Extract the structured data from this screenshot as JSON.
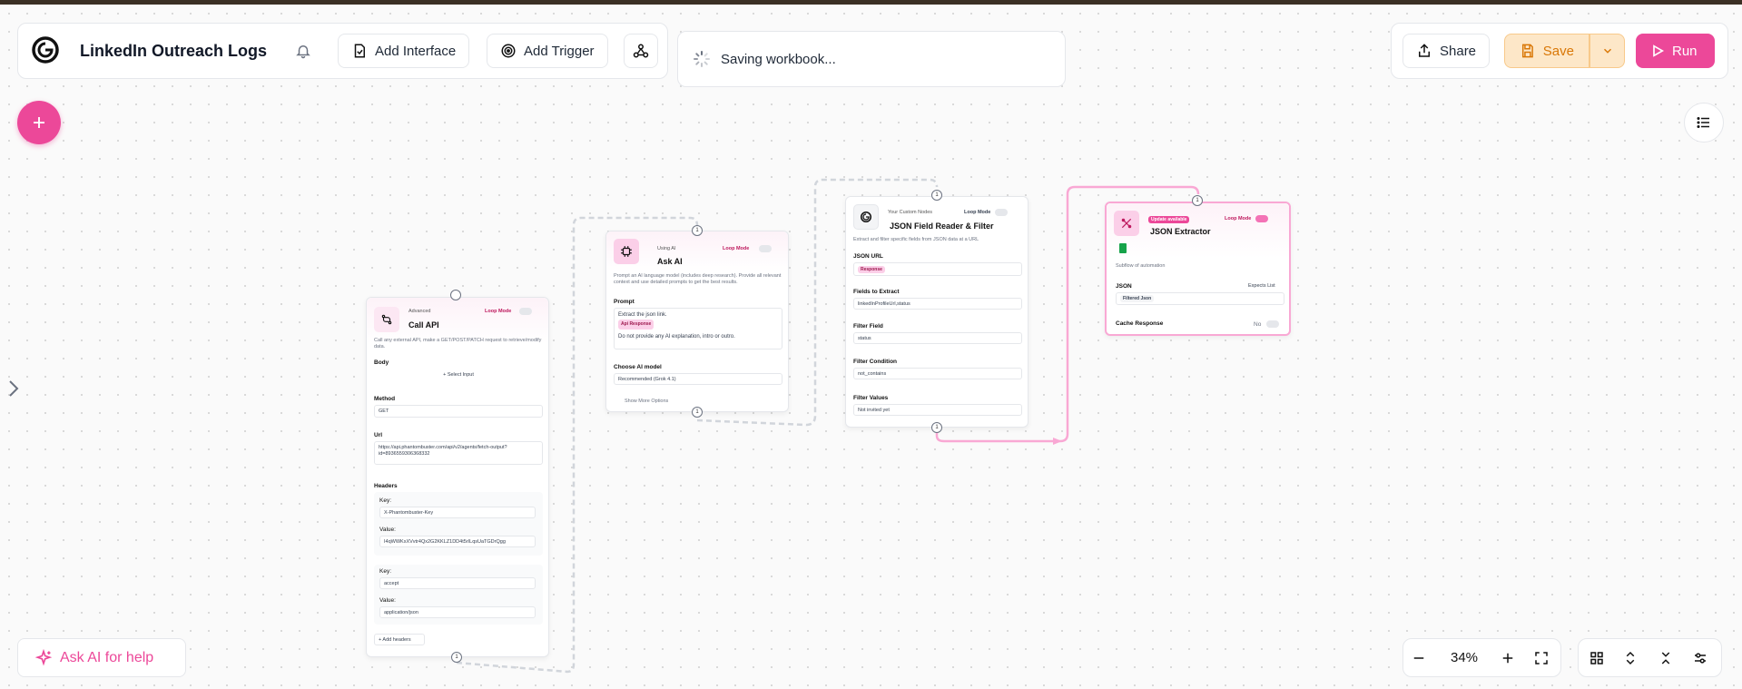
{
  "header": {
    "title": "LinkedIn Outreach Logs",
    "add_interface": "Add Interface",
    "add_trigger": "Add Trigger",
    "saving": "Saving workbook...",
    "share": "Share",
    "save": "Save",
    "run": "Run"
  },
  "ask_ai": "Ask AI for help",
  "zoom": "34%",
  "ports": {
    "one": "1"
  },
  "nodes": {
    "call_api": {
      "category": "Advanced",
      "name": "Call API",
      "loop_mode": "Loop Mode",
      "desc": "Call any external API, make a GET/POST/PATCH request to retrieve/modify data.",
      "body_label": "Body",
      "select_input": "+ Select Input",
      "method_label": "Method",
      "method_value": "GET",
      "url_label": "Url",
      "url_value": "https://api.phantombuster.com/api/v2/agents/fetch-output?id=8936559306368332",
      "headers_label": "Headers",
      "key_label": "Key:",
      "value_label": "Value:",
      "h1_key": "X-Phantombuster-Key",
      "h1_value": "I4qWWKxXVvtr4Qx2G2KKLZ1DD4t5rILqsUaTGDrQgg",
      "h2_key": "accept",
      "h2_value": "application/json",
      "add_headers": "+ Add headers"
    },
    "ask_ai": {
      "category": "Using AI",
      "name": "Ask AI",
      "loop_mode": "Loop Mode",
      "desc": "Prompt an AI language model (includes deep research). Provide all relevant context and use detailed prompts to get the best results.",
      "prompt_label": "Prompt",
      "prompt_line1": "Extract the json link.",
      "prompt_chip": "Api Response",
      "prompt_line2": "Do not provide any AI explanation, intro or outro.",
      "model_label": "Choose AI model",
      "model_value": "Recommended (Grok 4.1)",
      "more": "Show More Options"
    },
    "json_reader": {
      "category": "Your Custom Nodes",
      "name": "JSON Field Reader & Filter",
      "loop_mode": "Loop Mode",
      "desc": "Extract and filter specific fields from JSON data at a URL",
      "url_label": "JSON URL",
      "url_chip": "Response",
      "fields_label": "Fields to Extract",
      "fields_value": "linkedInProfileUrl,status",
      "filter_field_label": "Filter Field",
      "filter_field_value": "status",
      "condition_label": "Filter Condition",
      "condition_value": "not_contains",
      "values_label": "Filter Values",
      "values_value": "Not invited yet"
    },
    "json_extractor": {
      "badge": "Update available",
      "name": "JSON Extractor",
      "loop_mode": "Loop Mode",
      "desc": "Subflow of automation",
      "json_label": "JSON",
      "expects": "Expects List",
      "json_chip": "Filtered Json",
      "cache_label": "Cache Response",
      "cache_value": "No"
    }
  },
  "colors": {
    "pink": "#ec4899",
    "orange_bg": "#fde7c8",
    "orange_text": "#d97706",
    "edge_pink": "#f9a8d4",
    "edge_gray": "#d1d5db"
  }
}
